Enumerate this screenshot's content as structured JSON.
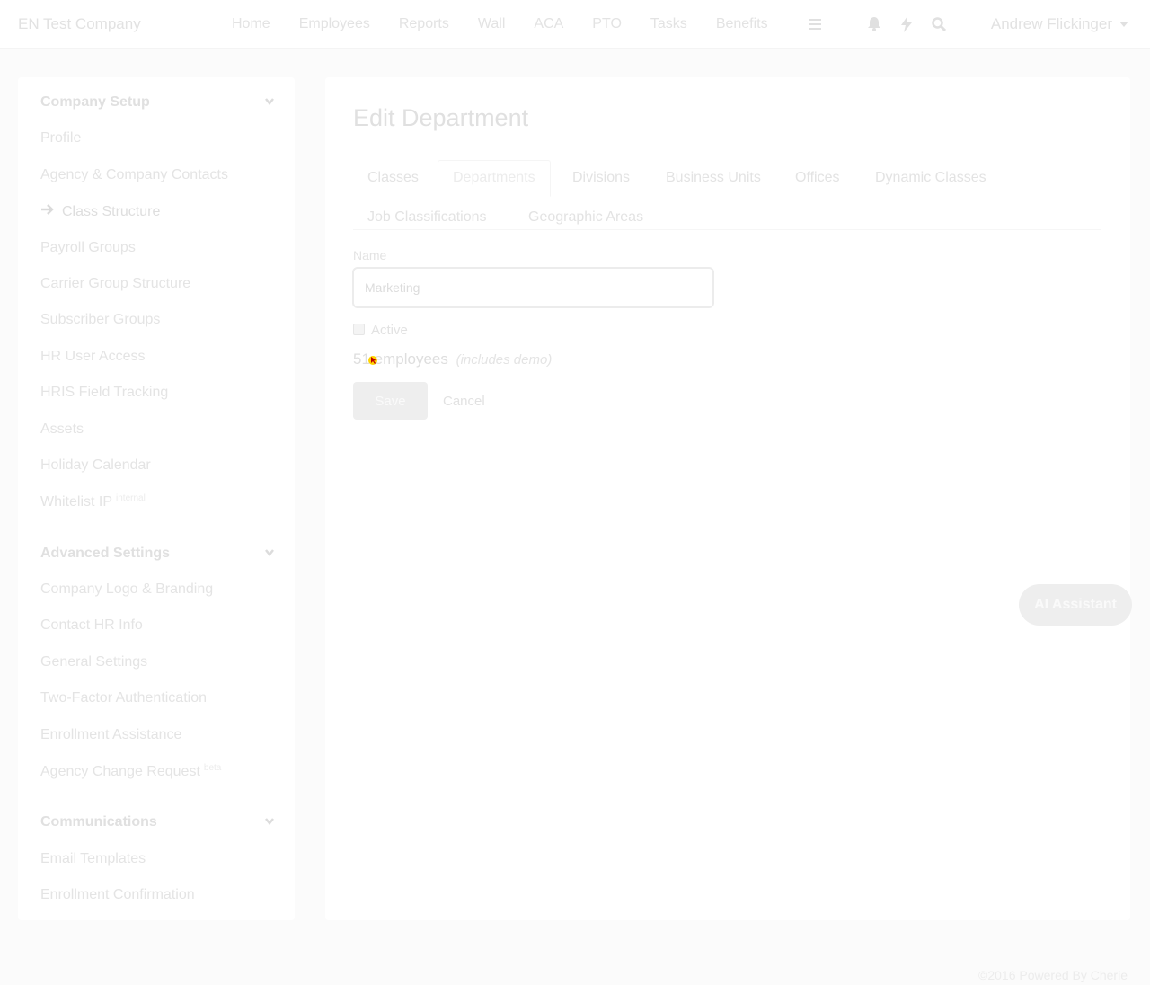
{
  "topbar": {
    "brand": "EN Test Company",
    "nav": [
      {
        "label": "Home",
        "name": "nav-home"
      },
      {
        "label": "Employees",
        "name": "nav-employees"
      },
      {
        "label": "Reports",
        "name": "nav-reports"
      },
      {
        "label": "Wall",
        "name": "nav-wall"
      },
      {
        "label": "ACA",
        "name": "nav-aca"
      },
      {
        "label": "PTO",
        "name": "nav-pto"
      },
      {
        "label": "Tasks",
        "name": "nav-tasks"
      },
      {
        "label": "Benefits",
        "name": "nav-benefits"
      }
    ],
    "icons": [
      "menu-icon",
      "bell-icon",
      "lightning-icon",
      "search-icon"
    ],
    "user_name": "Andrew Flickinger"
  },
  "sidebar": {
    "sections": [
      {
        "title": "Company Setup",
        "items": [
          {
            "label": "Profile"
          },
          {
            "label": "Agency & Company Contacts"
          },
          {
            "label": "Class Structure",
            "active": true
          },
          {
            "label": "Payroll Groups"
          },
          {
            "label": "Carrier Group Structure"
          },
          {
            "label": "Subscriber Groups"
          },
          {
            "label": "HR User Access"
          },
          {
            "label": "HRIS Field Tracking"
          },
          {
            "label": "Assets"
          },
          {
            "label": "Holiday Calendar"
          },
          {
            "label": "Whitelist IP",
            "badge": "internal"
          }
        ]
      },
      {
        "title": "Advanced Settings",
        "items": [
          {
            "label": "Company Logo & Branding"
          },
          {
            "label": "Contact HR Info"
          },
          {
            "label": "General Settings"
          },
          {
            "label": "Two-Factor Authentication"
          },
          {
            "label": "Enrollment Assistance"
          },
          {
            "label": "Agency Change Request",
            "badge": "beta"
          }
        ]
      },
      {
        "title": "Communications",
        "items": [
          {
            "label": "Email Templates"
          },
          {
            "label": "Enrollment Confirmation"
          }
        ]
      }
    ]
  },
  "main": {
    "title": "Edit Department",
    "tabs": [
      {
        "label": "Classes"
      },
      {
        "label": "Departments",
        "active": true
      },
      {
        "label": "Divisions"
      },
      {
        "label": "Business Units"
      },
      {
        "label": "Offices"
      },
      {
        "label": "Dynamic Classes"
      },
      {
        "label": "Job Classifications"
      },
      {
        "label": "Geographic Areas"
      }
    ],
    "name_label": "Name",
    "name_value": "Marketing",
    "active_label": "Active",
    "active_checked": false,
    "employee_count": "51",
    "employee_suffix": "employees",
    "employee_note": "(includes demo)",
    "save_label": "Save",
    "cancel_label": "Cancel"
  },
  "ai_assistant_label": "AI Assistant",
  "footer_text": "©2016 Powered By Cherie",
  "colors": {
    "background": "#fbfbfb",
    "panel": "#ffffff",
    "text_faint": "#e3e3e3",
    "button_bg": "#eeeeee"
  }
}
